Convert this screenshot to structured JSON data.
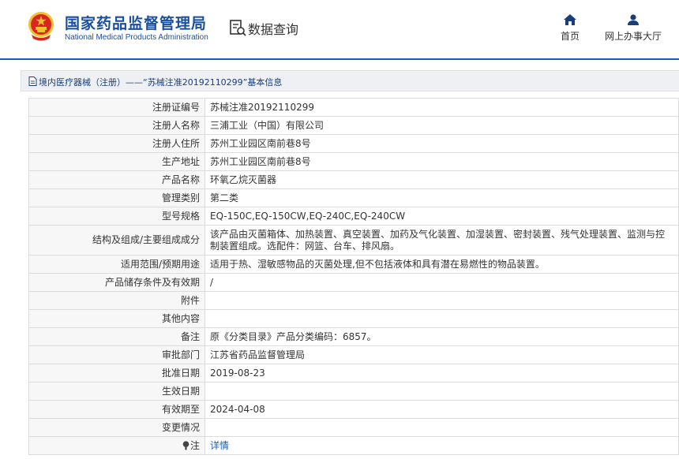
{
  "header": {
    "logo_cn": "国家药品监督管理局",
    "logo_en": "National Medical Products Administration",
    "query_title": "数据查询",
    "nav": [
      {
        "label": "首页",
        "icon": "home-icon"
      },
      {
        "label": "网上办事大厅",
        "icon": "user-icon"
      }
    ]
  },
  "breadcrumb": {
    "text": "境内医疗器械（注册）——“苏械注准20192110299”基本信息"
  },
  "detail": {
    "rows": [
      {
        "label": "注册证编号",
        "value": "苏械注准20192110299"
      },
      {
        "label": "注册人名称",
        "value": "三浦工业（中国）有限公司"
      },
      {
        "label": "注册人住所",
        "value": "苏州工业园区南前巷8号"
      },
      {
        "label": "生产地址",
        "value": "苏州工业园区南前巷8号"
      },
      {
        "label": "产品名称",
        "value": "环氧乙烷灭菌器"
      },
      {
        "label": "管理类别",
        "value": "第二类"
      },
      {
        "label": "型号规格",
        "value": "EQ-150C,EQ-150CW,EQ-240C,EQ-240CW"
      },
      {
        "label": "结构及组成/主要组成成分",
        "value": "该产品由灭菌箱体、加热装置、真空装置、加药及气化装置、加湿装置、密封装置、残气处理装置、监测与控制装置组成。选配件：网篮、台车、排风扇。"
      },
      {
        "label": "适用范围/预期用途",
        "value": "适用于热、湿敏感物品的灭菌处理,但不包括液体和具有潜在易燃性的物品装置。"
      },
      {
        "label": "产品储存条件及有效期",
        "value": "/"
      },
      {
        "label": "附件",
        "value": ""
      },
      {
        "label": "其他内容",
        "value": ""
      },
      {
        "label": "备注",
        "value": "原《分类目录》产品分类编码：6857。"
      },
      {
        "label": "审批部门",
        "value": "江苏省药品监督管理局"
      },
      {
        "label": "批准日期",
        "value": "2019-08-23"
      },
      {
        "label": "生效日期",
        "value": ""
      },
      {
        "label": "有效期至",
        "value": "2024-04-08"
      },
      {
        "label": "变更情况",
        "value": ""
      }
    ],
    "note_row": {
      "label": "注",
      "icon": "note-icon",
      "link": "详情"
    }
  },
  "colors": {
    "brand_blue": "#1a4fa0",
    "link_blue": "#1a5fb4",
    "emblem_red": "#d7261e",
    "emblem_gold": "#f2c12e"
  }
}
